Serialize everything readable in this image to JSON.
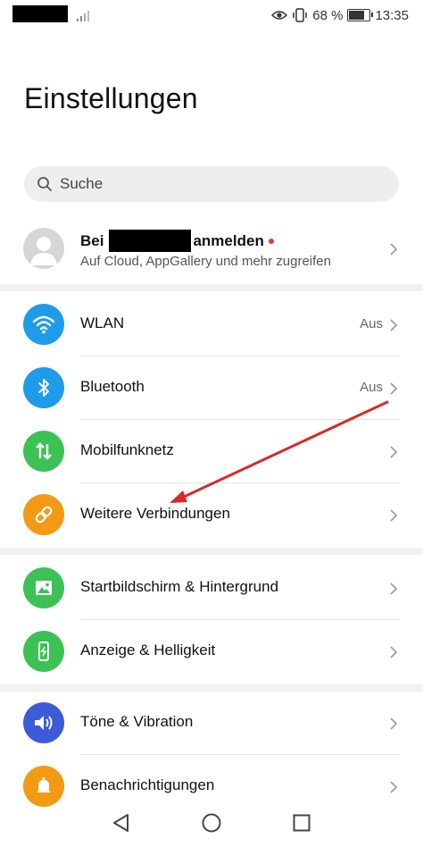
{
  "status_bar": {
    "battery_percent": "68 %",
    "time": "13:35"
  },
  "header": {
    "title": "Einstellungen"
  },
  "search": {
    "placeholder": "Suche"
  },
  "account": {
    "prefix": "Bei",
    "suffix": "anmelden",
    "subtitle": "Auf Cloud, AppGallery und mehr zugreifen"
  },
  "groups": [
    {
      "items": [
        {
          "label": "WLAN",
          "value": "Aus",
          "icon": "wifi-icon",
          "color": "#1e9be9"
        },
        {
          "label": "Bluetooth",
          "value": "Aus",
          "icon": "bluetooth-icon",
          "color": "#1e9be9"
        },
        {
          "label": "Mobilfunknetz",
          "value": "",
          "icon": "mobile-data-icon",
          "color": "#3cc155"
        },
        {
          "label": "Weitere Verbindungen",
          "value": "",
          "icon": "link-icon",
          "color": "#f29a13"
        }
      ]
    },
    {
      "items": [
        {
          "label": "Startbildschirm & Hintergrund",
          "value": "",
          "icon": "image-icon",
          "color": "#3cc155"
        },
        {
          "label": "Anzeige & Helligkeit",
          "value": "",
          "icon": "display-icon",
          "color": "#3cc155"
        }
      ]
    },
    {
      "items": [
        {
          "label": "Töne & Vibration",
          "value": "",
          "icon": "volume-icon",
          "color": "#3d5bd9"
        },
        {
          "label": "Benachrichtigungen",
          "value": "",
          "icon": "bell-icon",
          "color": "#f29a13"
        }
      ]
    }
  ],
  "annotation": {
    "color": "#d42b2b"
  }
}
